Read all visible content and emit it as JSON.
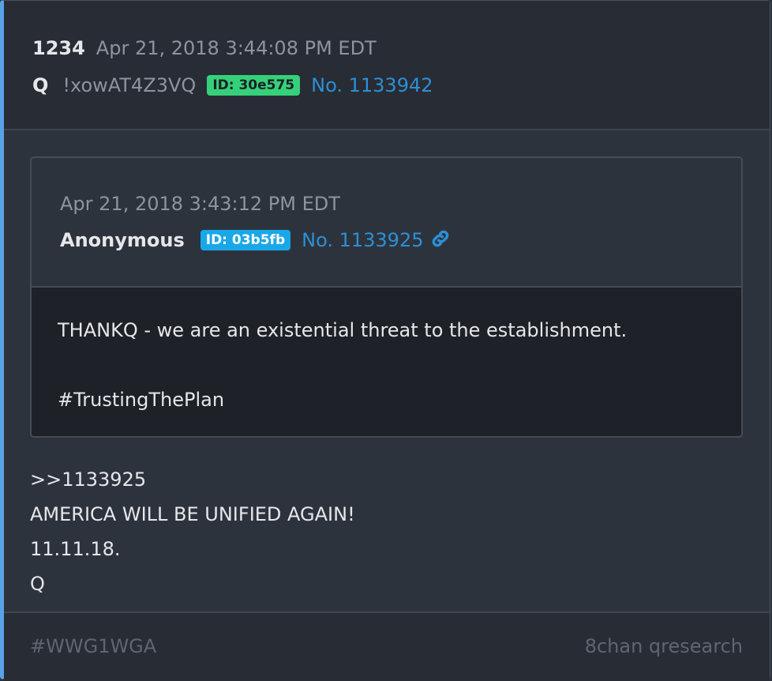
{
  "post": {
    "number": "1234",
    "timestamp": "Apr 21, 2018 3:44:08 PM EDT",
    "author": "Q",
    "tripcode": "!xowAT4Z3VQ",
    "id_badge": "ID: 30e575",
    "post_no": "No. 1133942",
    "lines": [
      ">>1133925",
      "AMERICA WILL BE UNIFIED AGAIN!",
      "11.11.18.",
      "Q"
    ]
  },
  "quoted": {
    "timestamp": "Apr 21, 2018 3:43:12 PM EDT",
    "author": "Anonymous",
    "id_badge": "ID: 03b5fb",
    "post_no": "No. 1133925",
    "icon": "link-icon",
    "body_line1": "THANKQ - we are an existential threat to the establishment.",
    "body_line2": "#TrustingThePlan"
  },
  "footer": {
    "hashtag": "#WWG1WGA",
    "source": "8chan qresearch"
  },
  "colors": {
    "accent_bar": "#5aa2e6",
    "link": "#2d8fd4",
    "badge_green": "#35d17a",
    "badge_blue": "#1aa7e8"
  }
}
